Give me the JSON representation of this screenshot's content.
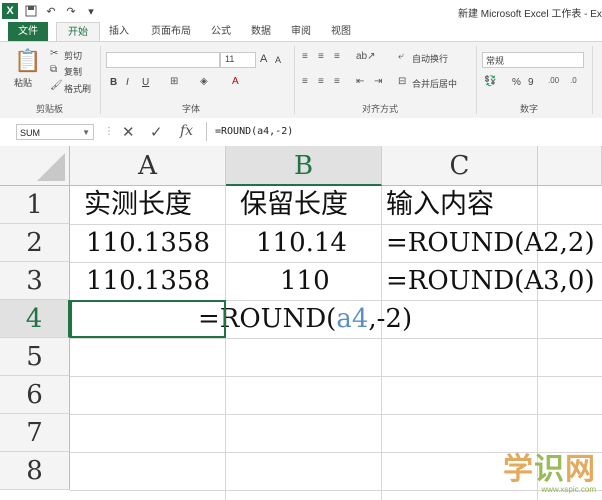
{
  "window": {
    "title": "新建 Microsoft Excel 工作表 - Exc",
    "logo": "X"
  },
  "qat": {
    "save_icon": "save-icon",
    "undo_icon": "undo-icon",
    "redo_icon": "redo-icon"
  },
  "tabs": [
    {
      "label": "文件"
    },
    {
      "label": "开始"
    },
    {
      "label": "插入"
    },
    {
      "label": "页面布局"
    },
    {
      "label": "公式"
    },
    {
      "label": "数据"
    },
    {
      "label": "审阅"
    },
    {
      "label": "视图"
    }
  ],
  "ribbon": {
    "clipboard": {
      "cut": "剪切",
      "copy": "复制",
      "format_painter": "格式刷",
      "paste": "粘贴",
      "label": "剪贴板"
    },
    "font": {
      "size": "11",
      "bold": "B",
      "italic": "I",
      "underline": "U",
      "label": "字体",
      "grow": "A",
      "shrink": "A"
    },
    "alignment": {
      "wrap": "自动换行",
      "merge": "合并后居中",
      "label": "对齐方式"
    },
    "number": {
      "format": "常规",
      "percent": "%",
      "comma": "9",
      "label": "数字"
    }
  },
  "formula_bar": {
    "name_box": "SUM",
    "formula": "=ROUND(a4,-2)"
  },
  "columns": [
    "A",
    "B",
    "C"
  ],
  "rows": [
    "1",
    "2",
    "3",
    "4",
    "5",
    "6",
    "7",
    "8"
  ],
  "cells": {
    "A1": "实测长度",
    "B1": "保留长度",
    "C1": "输入内容",
    "A2": "110.1358",
    "B2": "110.14",
    "C2": "=ROUND(A2,2)",
    "A3": "110.1358",
    "B3": "110",
    "C3": "=ROUND(A3,0)",
    "A4_prefix": "=ROUND(",
    "A4_ref": "a4",
    "A4_suffix": ",-2)"
  },
  "watermark": {
    "text_a": "学",
    "text_b": "识",
    "text_c": "网",
    "url": "www.xspic.com"
  },
  "colors": {
    "excel_green": "#217346",
    "ref_blue": "#5b8fc6",
    "header_gray": "#f4f4f4"
  }
}
